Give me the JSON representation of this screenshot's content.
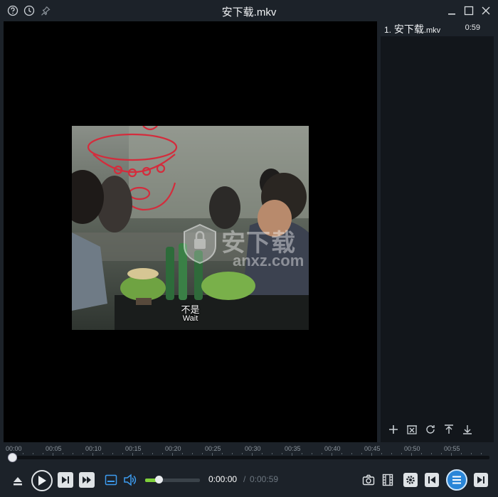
{
  "window": {
    "title": "安下载.mkv",
    "left_icons": [
      "help-icon",
      "history-icon",
      "pin-icon"
    ],
    "right_icons": [
      "minimize-icon",
      "maximize-icon",
      "close-icon"
    ]
  },
  "video": {
    "subtitle_cn": "不是",
    "subtitle_en": "Wait",
    "watermark_brand": "安下载",
    "watermark_domain": "anxz.com"
  },
  "playlist": {
    "items": [
      {
        "index": "1.",
        "name": "安下载",
        "ext": ".mkv",
        "duration": "0:59"
      }
    ],
    "tools": [
      "add-icon",
      "remove-icon",
      "refresh-icon",
      "move-up-icon",
      "move-down-icon"
    ]
  },
  "timeline": {
    "ticks": [
      "00:00",
      "00:05",
      "00:10",
      "00:15",
      "00:20",
      "00:25",
      "00:30",
      "00:35",
      "00:40",
      "00:45",
      "00:50",
      "00:55"
    ],
    "progress": 0.0
  },
  "controls": {
    "current_time": "0:00:00",
    "separator": "/",
    "total_time": "0:00:59",
    "volume": 0.25,
    "accent_color": "#2a86d8",
    "volume_color": "#7fd13b"
  }
}
